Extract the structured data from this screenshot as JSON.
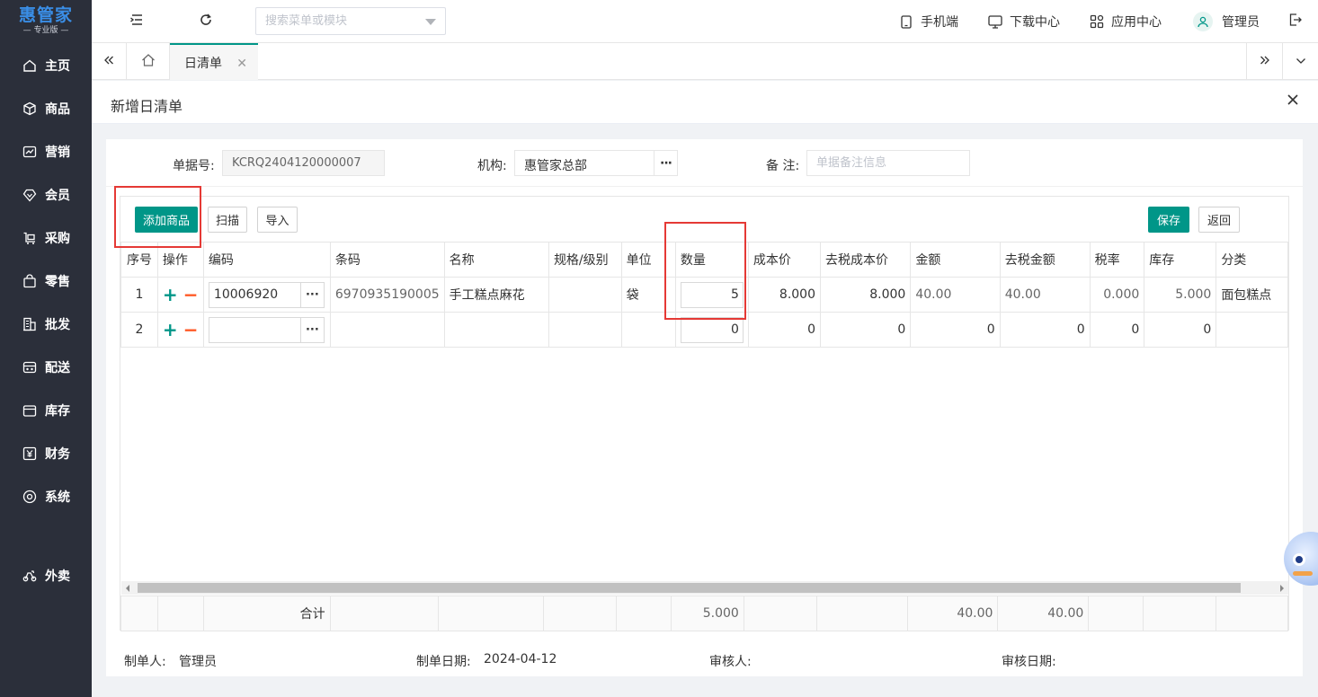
{
  "sidebar": {
    "logo_main": "惠管家",
    "logo_sub": "— 专业版 —",
    "items": [
      {
        "label": "主页",
        "icon": "home-icon"
      },
      {
        "label": "商品",
        "icon": "box-icon"
      },
      {
        "label": "营销",
        "icon": "chart-icon"
      },
      {
        "label": "会员",
        "icon": "diamond-icon"
      },
      {
        "label": "采购",
        "icon": "cart-icon"
      },
      {
        "label": "零售",
        "icon": "bag-icon"
      },
      {
        "label": "批发",
        "icon": "building-icon"
      },
      {
        "label": "配送",
        "icon": "truck-icon"
      },
      {
        "label": "库存",
        "icon": "warehouse-icon"
      },
      {
        "label": "财务",
        "icon": "yen-icon"
      },
      {
        "label": "系统",
        "icon": "gear-icon"
      },
      {
        "label": "外卖",
        "icon": "scooter-icon"
      }
    ]
  },
  "topbar": {
    "search_placeholder": "搜索菜单或模块",
    "mobile": "手机端",
    "download": "下载中心",
    "apps": "应用中心",
    "user": "管理员"
  },
  "tabs": [
    {
      "label": "日清单"
    }
  ],
  "page": {
    "title": "新增日清单"
  },
  "form": {
    "doc_no_label": "单据号:",
    "doc_no": "KCRQ2404120000007",
    "org_label": "机构:",
    "org_value": "惠管家总部",
    "remark_label": "备 注:",
    "remark_placeholder": "单据备注信息"
  },
  "toolbar": {
    "add_goods": "添加商品",
    "scan": "扫描",
    "import": "导入",
    "save": "保存",
    "back": "返回"
  },
  "table": {
    "columns": [
      "序号",
      "操作",
      "编码",
      "条码",
      "名称",
      "规格/级别",
      "单位",
      "数量",
      "成本价",
      "去税成本价",
      "金额",
      "去税金额",
      "税率",
      "库存",
      "分类"
    ],
    "rows": [
      {
        "seq": "1",
        "code": "10006920",
        "barcode": "6970935190005",
        "name": "手工糕点麻花",
        "spec": "",
        "unit": "袋",
        "qty": "5",
        "cost": "8.000",
        "cost_ex_tax": "8.000",
        "amount": "40.00",
        "amount_ex_tax": "40.00",
        "tax_rate": "0.000",
        "stock": "5.000",
        "category": "面包糕点"
      },
      {
        "seq": "2",
        "code": "",
        "barcode": "",
        "name": "",
        "spec": "",
        "unit": "",
        "qty": "0",
        "cost": "0",
        "cost_ex_tax": "0",
        "amount": "0",
        "amount_ex_tax": "0",
        "tax_rate": "0",
        "stock": "0",
        "category": ""
      }
    ],
    "totals": {
      "label": "合计",
      "qty": "5.000",
      "amount": "40.00",
      "amount_ex_tax": "40.00"
    }
  },
  "footer": {
    "maker_label": "制单人:",
    "maker": "管理员",
    "date_label": "制单日期:",
    "date": "2024-04-12",
    "auditor_label": "审核人:",
    "audit_date_label": "审核日期:"
  },
  "colors": {
    "primary": "#009688",
    "sidebar": "#2b2f3a",
    "highlight": "#e53935",
    "minus": "#ff5722"
  }
}
